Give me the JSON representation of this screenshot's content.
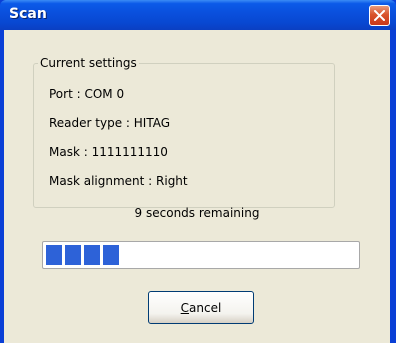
{
  "window": {
    "title": "Scan"
  },
  "settings": {
    "legend": "Current settings",
    "port": "Port : COM 0",
    "reader_type": "Reader type : HITAG",
    "mask": "Mask : 1111111110",
    "mask_alignment": "Mask alignment : Right"
  },
  "status": {
    "remaining_text": "9 seconds remaining"
  },
  "progress": {
    "level": 0.24,
    "color": "#2d62d8"
  },
  "buttons": {
    "cancel_mnemonic": "C",
    "cancel_rest": "ancel"
  },
  "icons": {
    "close": "close-icon"
  }
}
